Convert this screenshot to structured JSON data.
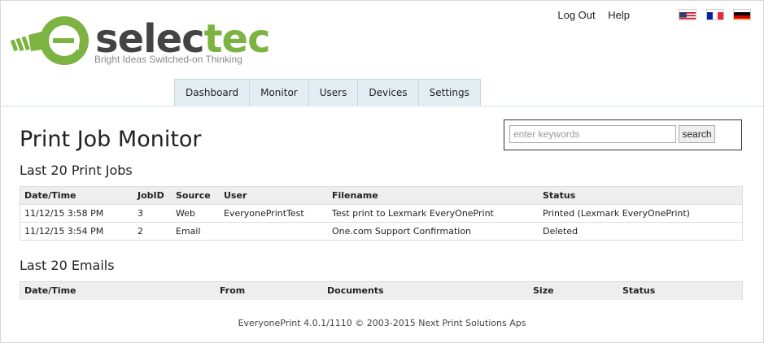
{
  "brand": {
    "word_dark": "selec",
    "word_green": "tec",
    "tagline": "Bright Ideas   Switched-on Thinking",
    "green": "#7cb342",
    "logo_icon": "lightbulb-e-icon"
  },
  "top_links": {
    "logout": "Log Out",
    "help": "Help"
  },
  "flags": [
    {
      "name": "flag-us-icon"
    },
    {
      "name": "flag-fr-icon"
    },
    {
      "name": "flag-de-icon"
    }
  ],
  "nav": {
    "tabs": [
      "Dashboard",
      "Monitor",
      "Users",
      "Devices",
      "Settings"
    ]
  },
  "page_title": "Print Job Monitor",
  "search": {
    "placeholder": "enter keywords",
    "value": "",
    "button": "search"
  },
  "jobs_section": {
    "title": "Last 20 Print Jobs",
    "columns": [
      "Date/Time",
      "JobID",
      "Source",
      "User",
      "Filename",
      "Status"
    ],
    "rows": [
      [
        "11/12/15 3:58 PM",
        "3",
        "Web",
        "EveryonePrintTest",
        "Test print to Lexmark EveryOnePrint",
        "Printed (Lexmark EveryOnePrint)"
      ],
      [
        "11/12/15 3:54 PM",
        "2",
        "Email",
        "",
        "One.com Support Confirmation",
        "Deleted"
      ]
    ]
  },
  "emails_section": {
    "title": "Last 20 Emails",
    "columns": [
      "Date/Time",
      "From",
      "Documents",
      "Size",
      "Status"
    ]
  },
  "footer": "EveryonePrint 4.0.1/1110 © 2003-2015 Next Print Solutions Aps"
}
